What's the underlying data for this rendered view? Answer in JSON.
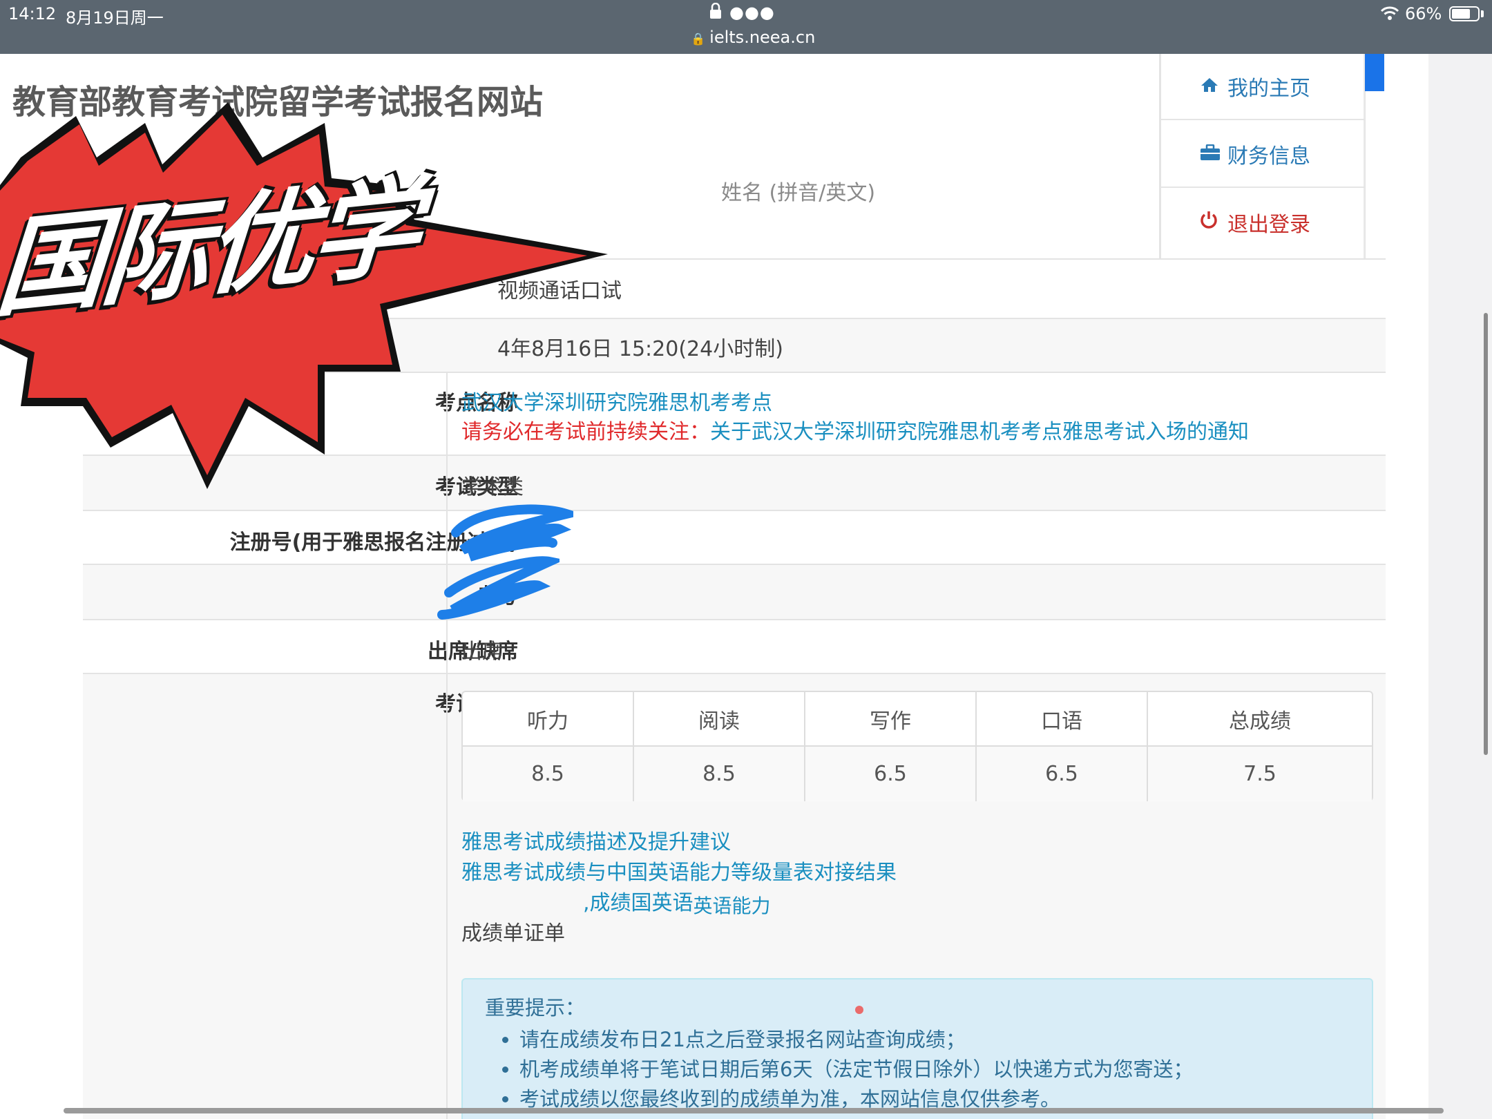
{
  "status_bar": {
    "time": "14:12",
    "date": "8月19日周一",
    "url": "ielts.neea.cn",
    "battery": "66%"
  },
  "site": {
    "title": "教育部教育考试院留学考试报名网站"
  },
  "nav_menu": {
    "items": [
      {
        "label": "我的主页",
        "icon": "home-icon"
      },
      {
        "label": "财务信息",
        "icon": "briefcase-icon"
      },
      {
        "label": "退出登录",
        "icon": "power-icon"
      }
    ]
  },
  "name_field": "姓名 (拼音/英文)",
  "details": {
    "exam_form": "视频通话口试",
    "exam_time": "4年8月16日 15:20(24小时制)",
    "venue_label": "考点名称",
    "venue_value": "武汉大学深圳研究院雅思机考考点",
    "venue_notice_prefix": "请务必在考试前持续关注：",
    "venue_notice_link": "关于武汉大学深圳研究院雅思机考考点雅思考试入场的通知",
    "type_label": "考试类型",
    "type_value": "学术类",
    "reg_label": "注册号(用于雅思报名注册过程)",
    "candidate_label": "考号",
    "attendance_label": "出席/缺席",
    "attendance_value": "出席",
    "score_label": "考试成绩"
  },
  "scores": {
    "headers": [
      "听力",
      "阅读",
      "写作",
      "口语",
      "总成绩"
    ],
    "values": [
      "8.5",
      "8.5",
      "6.5",
      "6.5",
      "7.5"
    ]
  },
  "score_links": [
    "雅思考试成绩描述及提升建议",
    "雅思考试成绩与中国英语能力等级量表对接结果",
    ",成绩国英语",
    "英语能力",
    "成绩单证单"
  ],
  "notice": {
    "title": "重要提示：",
    "items": [
      "请在成绩发布日21点之后登录报名网站查询成绩；",
      "机考成绩单将于笔试日期后第6天（法定节假日除外）以快递方式为您寄送；",
      "考试成绩以您最终收到的成绩单为准，本网站信息仅供参考。"
    ]
  },
  "sticker": {
    "text": "国际优学"
  },
  "colors": {
    "link": "#1a8fc0",
    "warning": "#e0292b",
    "sticker_red": "#e53935",
    "notice_bg": "#d9edf7",
    "scribble": "#1e7fe8"
  }
}
